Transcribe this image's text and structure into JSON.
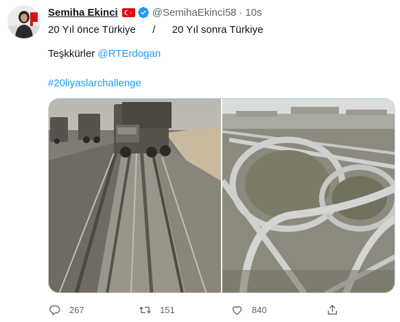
{
  "tweet": {
    "author": {
      "name": "Semiha Ekinci",
      "handle": "@SemihaEkinci58",
      "flag_icon": "turkey-flag-icon",
      "verified_icon": "verified-badge-icon"
    },
    "separator": "·",
    "time": "10s",
    "text": {
      "line1_part1": "20 Yıl önce Türkiye",
      "line1_slash": "/",
      "line1_part2": "20 Yıl sonra Türkiye",
      "line2_prefix": "Teşkkürler",
      "mention": "@RTErdogan",
      "hashtag": "#20liyaslarchallenge"
    },
    "actions": {
      "reply_count": "267",
      "retweet_count": "151",
      "like_count": "840"
    },
    "colors": {
      "link": "#1d9bf0",
      "secondary": "#536471",
      "verified": "#1d9bf0",
      "flag_red": "#e30a17"
    }
  }
}
